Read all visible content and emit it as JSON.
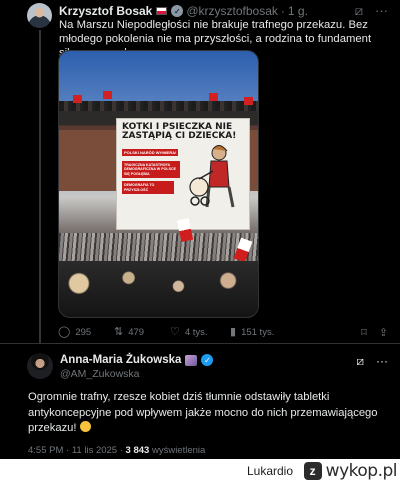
{
  "tweet1": {
    "author_name": "Krzysztof Bosak",
    "handle": "@krzysztofbosak",
    "time": "1 g.",
    "separator": "·",
    "text": "Na Marszu Niepodległości nie brakuje trafnego przekazu. Bez młodego pokolenia nie ma przyszłości, a rodzina to fundament silnego narodu.",
    "image": {
      "banner_heading": "KOTKI I PSIECZKA NIE ZASTĄPIĄ CI DZIECKA!",
      "banner_sub": "POLSKI NARÓD WYMIERA!",
      "banner_list": "TRAGICZNA KATASTROFA DEMOGRAFICZNA W POLSCE SIĘ POGŁĘBIA",
      "banner_list2": "DEMOGRAFIA TO PRZYSZŁOŚĆ"
    },
    "stats": {
      "replies": "295",
      "reposts": "479",
      "likes": "4 tys.",
      "views": "151 tys."
    }
  },
  "tweet2": {
    "author_name": "Anna-Maria Żukowska",
    "handle": "@AM_Zukowska",
    "text": "Ogromnie trafny, rzesze kobiet dziś tłumnie odstawiły tabletki antykoncepcyjne pod wpływem jakże mocno do nich przemawiającego przekazu!",
    "time": "4:55 PM",
    "date": "11 lis 2025",
    "views_count": "3 843",
    "views_label": "wyświetlenia",
    "dot": "·"
  },
  "footer": {
    "username": "Lukardio",
    "badge": "z",
    "site": "wykop.pl"
  },
  "colors": {
    "background": "#000000",
    "text": "#e7e9ea",
    "muted": "#71767b",
    "verified_blue": "#1d9bf0",
    "verified_gray": "#8b98a5"
  },
  "icons": {
    "grok": "grok-icon",
    "more": "more-icon",
    "reply": "reply-icon",
    "repost": "repost-icon",
    "like": "heart-icon",
    "views": "views-icon",
    "bookmark": "bookmark-icon",
    "share": "share-icon"
  }
}
